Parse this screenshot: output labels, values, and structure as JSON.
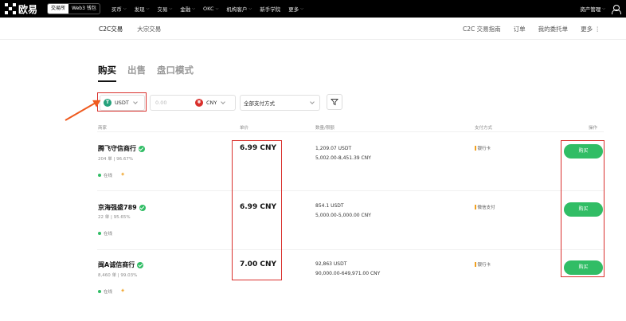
{
  "brand": {
    "name": "欧易"
  },
  "topnav": {
    "segments": [
      "交易所",
      "Web3 钱包"
    ],
    "items": [
      {
        "label": "买币"
      },
      {
        "label": "发现"
      },
      {
        "label": "交易"
      },
      {
        "label": "金融"
      },
      {
        "label": "OKC"
      },
      {
        "label": "机构客户"
      },
      {
        "label": "新手学院"
      },
      {
        "label": "更多"
      }
    ],
    "right": {
      "assets": "资产管理"
    }
  },
  "subnav": {
    "left": [
      "C2C交易",
      "大宗交易"
    ],
    "right": [
      "C2C 交易指南",
      "订单",
      "我的委托单",
      "更多"
    ]
  },
  "mode_tabs": [
    "购买",
    "出售",
    "盘口模式"
  ],
  "filters": {
    "coin": {
      "label": "USDT",
      "icon": "T"
    },
    "amount_placeholder": "0.00",
    "fiat": {
      "label": "CNY",
      "icon": "¥"
    },
    "payment": "全部支付方式"
  },
  "table": {
    "headers": [
      "商家",
      "单价",
      "数量/限额",
      "支付方式",
      "操作"
    ],
    "rows": [
      {
        "merchant": "腾飞守信商行",
        "orders": "204 单",
        "completion": "96.67%",
        "status": "在线",
        "price": "6.99 CNY",
        "quantity": "1,209.07 USDT",
        "limit": "5,002.00-8,451.39 CNY",
        "payment": "银行卡",
        "action": "购买"
      },
      {
        "merchant": "京海强盛789",
        "orders": "22 单",
        "completion": "95.65%",
        "status": "在线",
        "price": "6.99 CNY",
        "quantity": "854.1 USDT",
        "limit": "5,000.00-5,000.00 CNY",
        "payment": "微信支付",
        "action": "购买"
      },
      {
        "merchant": "闽A诚信商行",
        "orders": "8,460 单",
        "completion": "99.03%",
        "status": "在线",
        "price": "7.00 CNY",
        "quantity": "92,863 USDT",
        "limit": "90,000.00-649,971.00 CNY",
        "payment": "银行卡",
        "action": "购买"
      }
    ]
  },
  "colors": {
    "accent_green": "#31bd65",
    "annotation_red": "#d9302c",
    "arrow_orange": "#ef5a1e",
    "nav_bg": "#000000"
  }
}
